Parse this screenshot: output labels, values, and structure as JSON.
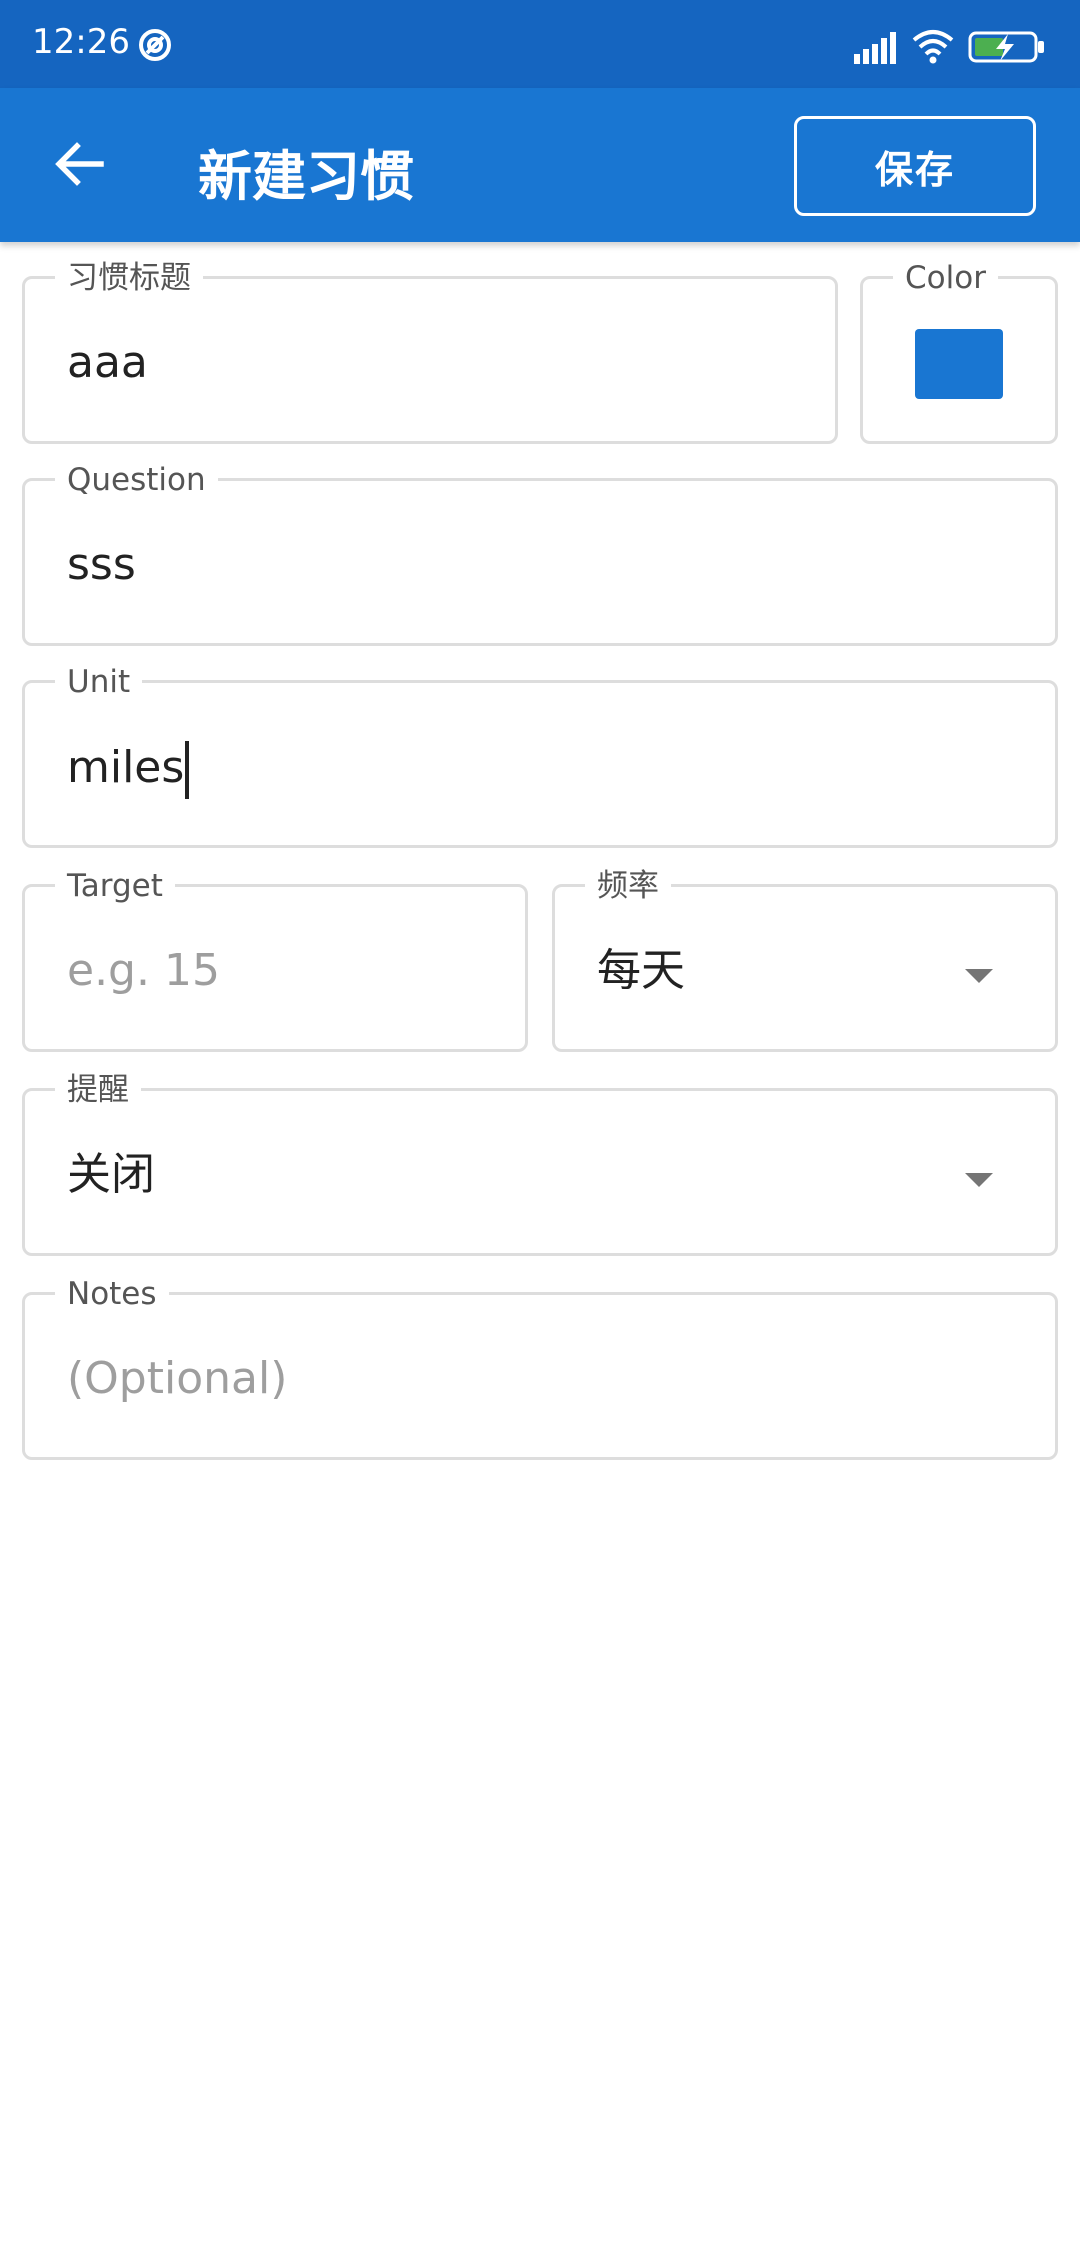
{
  "status": {
    "time": "12:26"
  },
  "appbar": {
    "title": "新建习惯",
    "save_label": "保存"
  },
  "form": {
    "habit_title": {
      "label": "习惯标题",
      "value": "aaa"
    },
    "color": {
      "label": "Color",
      "value": "#1976d2"
    },
    "question": {
      "label": "Question",
      "value": "sss"
    },
    "unit": {
      "label": "Unit",
      "value": "miles"
    },
    "target": {
      "label": "Target",
      "placeholder": "e.g. 15"
    },
    "frequency": {
      "label": "频率",
      "value": "每天"
    },
    "reminder": {
      "label": "提醒",
      "value": "关闭"
    },
    "notes": {
      "label": "Notes",
      "placeholder": "(Optional)"
    }
  },
  "colors": {
    "statusbar": "#1565c0",
    "appbar": "#1976d2",
    "border": "#dddddd"
  }
}
